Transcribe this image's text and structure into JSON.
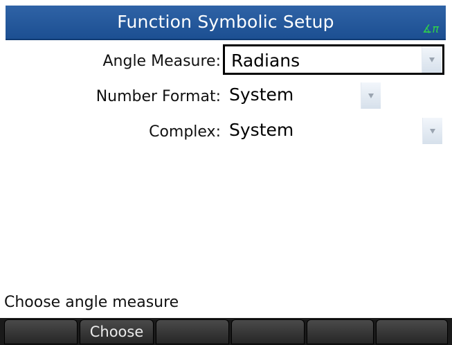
{
  "title": "Function Symbolic Setup",
  "angle_indicator": "∡π",
  "fields": {
    "angle_measure": {
      "label": "Angle Measure:",
      "value": "Radians"
    },
    "number_format": {
      "label": "Number Format:",
      "value": "System"
    },
    "complex": {
      "label": "Complex:",
      "value": "System"
    }
  },
  "help_text": "Choose angle measure",
  "softkeys": [
    "",
    "Choose",
    "",
    "",
    "",
    ""
  ],
  "colors": {
    "titlebar": "#2f63a6",
    "angle_indicator": "#2fd24a",
    "softkey_bg": "#262626"
  }
}
